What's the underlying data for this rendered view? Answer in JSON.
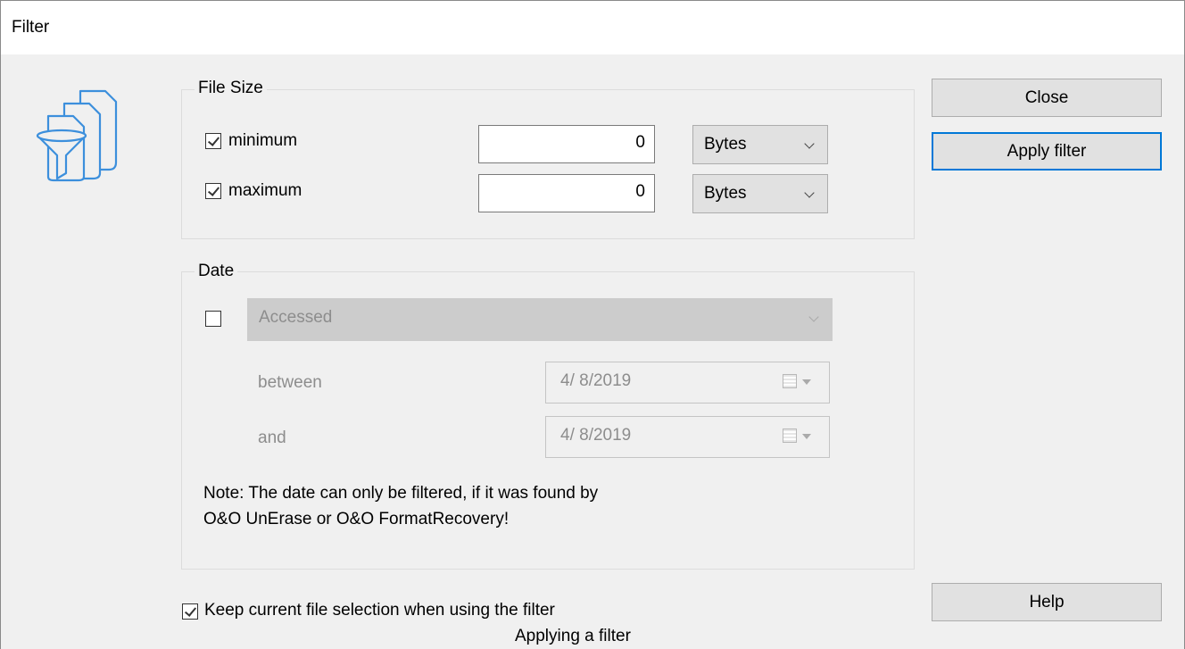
{
  "window": {
    "title": "Filter"
  },
  "file_size": {
    "group_label": "File Size",
    "minimum": {
      "label": "minimum",
      "checked": true,
      "value": "0",
      "unit": "Bytes"
    },
    "maximum": {
      "label": "maximum",
      "checked": true,
      "value": "0",
      "unit": "Bytes"
    }
  },
  "date": {
    "group_label": "Date",
    "enabled_checked": false,
    "type_selected": "Accessed",
    "between_label": "between",
    "between_value": "4/  8/2019",
    "and_label": "and",
    "and_value": "4/  8/2019",
    "note": "Note: The date can only be filtered, if it was found by O&O UnErase or O&O FormatRecovery!"
  },
  "buttons": {
    "close": "Close",
    "apply": "Apply filter",
    "help": "Help"
  },
  "keep_selection": {
    "label": "Keep current file selection when using the filter",
    "checked": true
  },
  "caption": "Applying a filter",
  "colors": {
    "accent": "#0078d7",
    "icon": "#3c8fdc",
    "background": "#f0f0f0"
  }
}
